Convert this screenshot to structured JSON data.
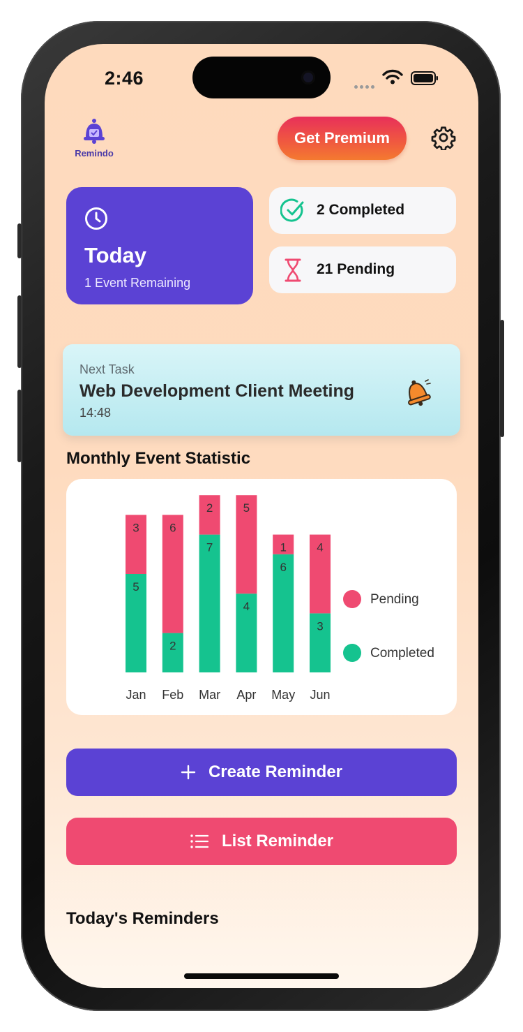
{
  "status_bar": {
    "time": "2:46"
  },
  "header": {
    "logo_text": "Remindo",
    "premium_label": "Get Premium"
  },
  "summary": {
    "today_title": "Today",
    "today_subtitle": "1 Event Remaining",
    "completed_label": "2 Completed",
    "pending_label": "21 Pending"
  },
  "next_task": {
    "label": "Next Task",
    "title": "Web Development Client Meeting",
    "time": "14:48"
  },
  "chart_section": {
    "title": "Monthly Event Statistic"
  },
  "chart_data": {
    "type": "bar",
    "stacked": true,
    "categories": [
      "Jan",
      "Feb",
      "Mar",
      "Apr",
      "May",
      "Jun"
    ],
    "series": [
      {
        "name": "Completed",
        "color": "#15c38f",
        "values": [
          5,
          2,
          7,
          4,
          6,
          3
        ]
      },
      {
        "name": "Pending",
        "color": "#ef4a71",
        "values": [
          3,
          6,
          2,
          5,
          1,
          4
        ]
      }
    ],
    "legend": [
      "Pending",
      "Completed"
    ],
    "legend_position": "right"
  },
  "actions": {
    "create_label": "Create Reminder",
    "list_label": "List Reminder"
  },
  "reminders_section": {
    "title": "Today's Reminders"
  },
  "colors": {
    "primary": "#5b42d4",
    "pending": "#ef4a71",
    "completed": "#15c38f"
  }
}
